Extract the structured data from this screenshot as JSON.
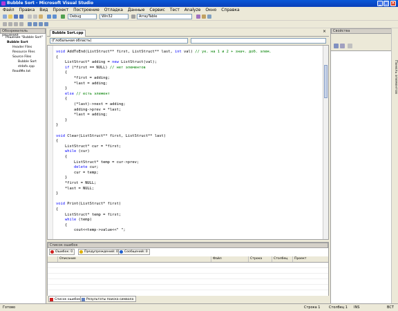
{
  "window": {
    "title": "Bubble Sort - Microsoft Visual Studio"
  },
  "menu": [
    "Файл",
    "Правка",
    "Вид",
    "Проект",
    "Построение",
    "Отладка",
    "Данные",
    "Сервис",
    "Тест",
    "Analyze",
    "Окно",
    "Справка"
  ],
  "toolbar": {
    "config": "Debug",
    "platform": "Win32",
    "find": "ArrayTable"
  },
  "solution_explorer": {
    "title": "Обозреватель решений",
    "items": [
      "Решение \"Bubble Sort\"",
      "Bubble Sort",
      "Header Files",
      "Resource Files",
      "Source Files",
      "Bubble Sort",
      "stdafx.cpp",
      "ReadMe.txt"
    ]
  },
  "editor": {
    "tab": "Bubble Sort.cpp",
    "scope": "(Глобальная область)",
    "lines": [
      "void AddToEnd(ListStruct** first, ListStruct** last, int val) // ук. на 1 и 2 + знач. доб. элем.",
      "{",
      "    ListStruct* adding = new ListStruct(val);",
      "    if (*first == NULL) // нет элементов",
      "    {",
      "        *first = adding;",
      "        *last = adding;",
      "    }",
      "    else // есть элемент",
      "    {",
      "        (*last)->next = adding;",
      "        adding->prev = *last;",
      "        *last = adding;",
      "    }",
      "}",
      "",
      "void Clear(ListStruct** first, ListStruct** last)",
      "{",
      "    ListStruct* cur = *first;",
      "    while (cur)",
      "    {",
      "        ListStruct* temp = cur->prev;",
      "        delete cur;",
      "        cur = temp;",
      "    }",
      "    *first = NULL;",
      "    *last = NULL;",
      "}",
      "",
      "void Print(ListStruct* first)",
      "{",
      "    ListStruct* temp = first;",
      "    while (temp)",
      "    {",
      "        cout<<temp->value<<\" \";"
    ]
  },
  "error_list": {
    "title": "Список ошибок",
    "errors": "Ошибок: 0",
    "warnings": "Предупреждений: 0",
    "messages": "Сообщений: 0",
    "columns": [
      "Описание",
      "Файл",
      "Строка",
      "Столбец",
      "Проект"
    ]
  },
  "bottom_tabs": [
    "Список ошибок",
    "Результаты поиска символа"
  ],
  "properties": {
    "title": "Свойства",
    "side_label": "Панель элементов"
  },
  "status": {
    "left": "Готово",
    "line": "Строка 1",
    "col": "Столбец 1",
    "ins": "INS",
    "mode": "ВСТ"
  },
  "colors": {
    "titlebar": "#0a4dcc",
    "keyword": "#0000ff",
    "comment": "#008000",
    "error": "#d02020",
    "warning": "#e0b000",
    "message": "#2060d0"
  }
}
